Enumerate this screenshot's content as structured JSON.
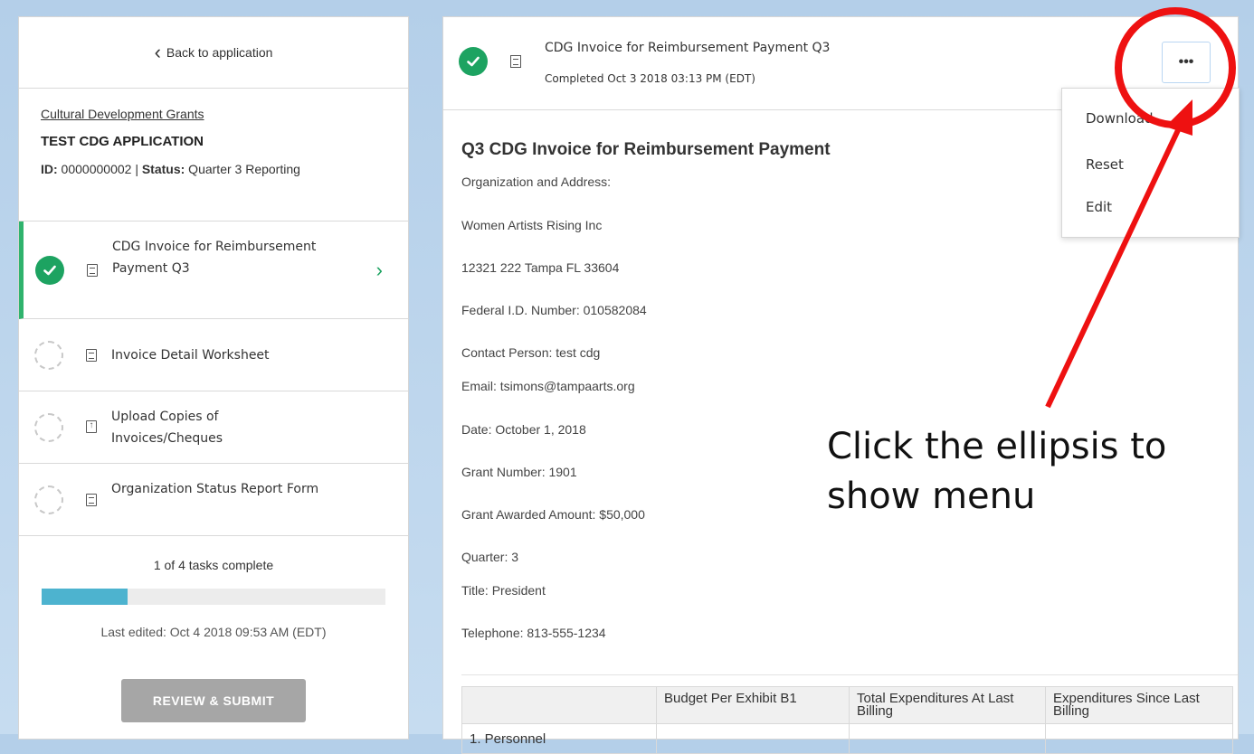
{
  "sidebar": {
    "back_label": "Back to application",
    "program_link": "Cultural Development Grants",
    "app_title": "TEST CDG APPLICATION",
    "id_label": "ID:",
    "id_value": " 0000000002 | ",
    "status_label": "Status:",
    "status_value": " Quarter 3 Reporting",
    "tasks": [
      {
        "label": "CDG Invoice for Reimbursement Payment Q3",
        "state": "complete",
        "icon": "document-icon"
      },
      {
        "label": "Invoice Detail Worksheet",
        "state": "incomplete",
        "icon": "document-icon"
      },
      {
        "label": "Upload Copies of Invoices/Cheques",
        "state": "incomplete",
        "icon": "upload-icon"
      },
      {
        "label": "Organization Status Report Form",
        "state": "incomplete",
        "icon": "document-icon"
      }
    ],
    "progress_text": "1 of 4 tasks complete",
    "progress_fraction": 0.25,
    "last_edited": "Last edited: Oct 4 2018 09:53 AM (EDT)",
    "review_button": "REVIEW & SUBMIT"
  },
  "task_header": {
    "title": "CDG Invoice for Reimbursement Payment Q3",
    "completed": "Completed Oct 3 2018 03:13 PM (EDT)",
    "ellipsis": "•••"
  },
  "menu": {
    "items": [
      "Download",
      "Reset",
      "Edit"
    ]
  },
  "form": {
    "title": "Q3 CDG Invoice for Reimbursement Payment",
    "fields": [
      "Organization and Address:",
      "Women Artists Rising Inc",
      "12321 222 Tampa FL 33604",
      "Federal I.D. Number: 010582084",
      "Contact Person: test cdg",
      "Email: tsimons@tampaarts.org",
      "Date: October 1, 2018",
      "Grant Number: 1901",
      "Grant Awarded Amount: $50,000",
      "Quarter: 3",
      "Title: President",
      "Telephone:  813-555-1234"
    ],
    "table": {
      "headers": [
        "",
        "Budget Per Exhibit B1",
        "Total Expenditures At Last Billing",
        "Expenditures Since Last Billing"
      ],
      "first_row_label": "1. Personnel"
    }
  },
  "annotation": {
    "text": "Click the ellipsis to show menu",
    "color": "#ee1111"
  },
  "colors": {
    "accent_green": "#1da361",
    "progress_blue": "#4db3cf",
    "button_gray": "#a6a6a6"
  }
}
